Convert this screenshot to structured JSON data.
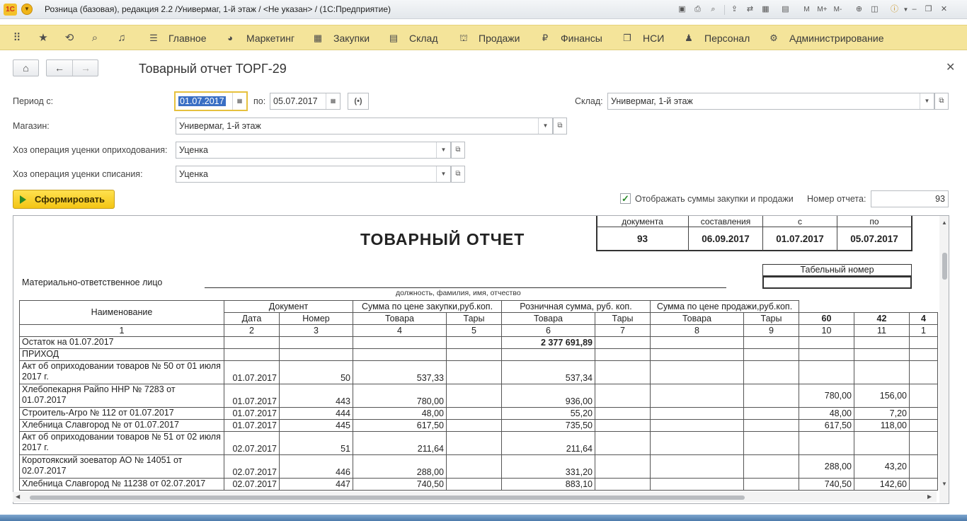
{
  "window": {
    "logo_text": "1С",
    "title": "Розница (базовая), редакция 2.2 /Универмаг, 1-й этаж / <Не указан> /  (1С:Предприятие)",
    "toolbar_text_icons": [
      "M",
      "M+",
      "M-"
    ]
  },
  "main_menu": {
    "items": [
      {
        "label": "Главное",
        "icon": "list-icon"
      },
      {
        "label": "Маркетинг",
        "icon": "pie-icon"
      },
      {
        "label": "Закупки",
        "icon": "cart-grid-icon"
      },
      {
        "label": "Склад",
        "icon": "warehouse-icon"
      },
      {
        "label": "Продажи",
        "icon": "basket-icon"
      },
      {
        "label": "Финансы",
        "icon": "ruble-icon"
      },
      {
        "label": "НСИ",
        "icon": "book-icon"
      },
      {
        "label": "Персонал",
        "icon": "person-icon"
      },
      {
        "label": "Администрирование",
        "icon": "gear-icon"
      }
    ]
  },
  "document": {
    "title": "Товарный отчет ТОРГ-29"
  },
  "form": {
    "period_label": "Период  с:",
    "period_from": "01.07.2017",
    "period_to_label": "по:",
    "period_to": "05.07.2017",
    "warehouse_label": "Склад:",
    "warehouse": "Универмаг, 1-й этаж",
    "store_label": "Магазин:",
    "store": "Универмаг, 1-й этаж",
    "op_in_label": "Хоз операция уценки оприходования:",
    "op_in": "Уценка",
    "op_out_label": "Хоз операция уценки списания:",
    "op_out": "Уценка",
    "generate_label": "Сформировать",
    "show_sums_label": "Отображать суммы закупки и продажи",
    "show_sums_checked": true,
    "report_number_label": "Номер отчета:",
    "report_number": "93"
  },
  "report": {
    "title": "ТОВАРНЫЙ  ОТЧЕТ",
    "header_cols": [
      "документа",
      "составления",
      "с",
      "по"
    ],
    "header_vals": [
      "93",
      "06.09.2017",
      "01.07.2017",
      "05.07.2017"
    ],
    "mol_label": "Материально-ответственное лицо",
    "mol_sub": "должность, фамилия, имя, отчество",
    "tabel_label": "Табельный номер",
    "col_name": "Наименование",
    "grp_doc": "Документ",
    "grp_purchase": "Сумма по цене закупки,руб.коп.",
    "grp_retail": "Розничная сумма, руб. коп.",
    "grp_sale": "Сумма по цене продажи,руб.коп.",
    "sub_date": "Дата",
    "sub_num": "Номер",
    "sub_goods": "Товара",
    "sub_tare": "Тары",
    "extra_cols": [
      "60",
      "42",
      "4"
    ],
    "col_numbers": [
      "1",
      "2",
      "3",
      "4",
      "5",
      "6",
      "7",
      "8",
      "9",
      "10",
      "11",
      "1"
    ],
    "rows": [
      {
        "name": "Остаток на 01.07.2017",
        "date": "",
        "num": "",
        "pg": "",
        "pt": "",
        "rg": "2 377 691,89",
        "rt": "",
        "sg": "",
        "st": "",
        "e1": "",
        "e2": "",
        "bold_rg": true
      },
      {
        "name": "ПРИХОД",
        "date": "",
        "num": "",
        "pg": "",
        "pt": "",
        "rg": "",
        "rt": "",
        "sg": "",
        "st": "",
        "e1": "",
        "e2": ""
      },
      {
        "name": "Акт об оприходовании товаров № 50 от 01 июля 2017 г.",
        "date": "01.07.2017",
        "num": "50",
        "pg": "537,33",
        "pt": "",
        "rg": "537,34",
        "rt": "",
        "sg": "",
        "st": "",
        "e1": "",
        "e2": "",
        "tall": true
      },
      {
        "name": "Хлебопекарня Райпо ННР № 7283 от 01.07.2017",
        "date": "01.07.2017",
        "num": "443",
        "pg": "780,00",
        "pt": "",
        "rg": "936,00",
        "rt": "",
        "sg": "",
        "st": "",
        "e1": "780,00",
        "e2": "156,00",
        "tall": true
      },
      {
        "name": "Строитель-Агро № 112 от 01.07.2017",
        "date": "01.07.2017",
        "num": "444",
        "pg": "48,00",
        "pt": "",
        "rg": "55,20",
        "rt": "",
        "sg": "",
        "st": "",
        "e1": "48,00",
        "e2": "7,20"
      },
      {
        "name": "Хлебница Славгород №  от 01.07.2017",
        "date": "01.07.2017",
        "num": "445",
        "pg": "617,50",
        "pt": "",
        "rg": "735,50",
        "rt": "",
        "sg": "",
        "st": "",
        "e1": "617,50",
        "e2": "118,00"
      },
      {
        "name": "Акт об оприходовании товаров № 51 от 02 июля 2017 г.",
        "date": "02.07.2017",
        "num": "51",
        "pg": "211,64",
        "pt": "",
        "rg": "211,64",
        "rt": "",
        "sg": "",
        "st": "",
        "e1": "",
        "e2": "",
        "tall": true
      },
      {
        "name": "Коротоякский зоеватор АО № 14051 от 02.07.2017",
        "date": "02.07.2017",
        "num": "446",
        "pg": "288,00",
        "pt": "",
        "rg": "331,20",
        "rt": "",
        "sg": "",
        "st": "",
        "e1": "288,00",
        "e2": "43,20",
        "tall": true
      },
      {
        "name": "Хлебница Славгород № 11238 от 02.07.2017",
        "date": "02.07.2017",
        "num": "447",
        "pg": "740,50",
        "pt": "",
        "rg": "883,10",
        "rt": "",
        "sg": "",
        "st": "",
        "e1": "740,50",
        "e2": "142,60"
      }
    ]
  },
  "colors": {
    "menu_bg": "#f4e49a",
    "generate_btn": "#f3c514",
    "focus_border": "#e6c13e",
    "selection": "#3a6fc4"
  }
}
